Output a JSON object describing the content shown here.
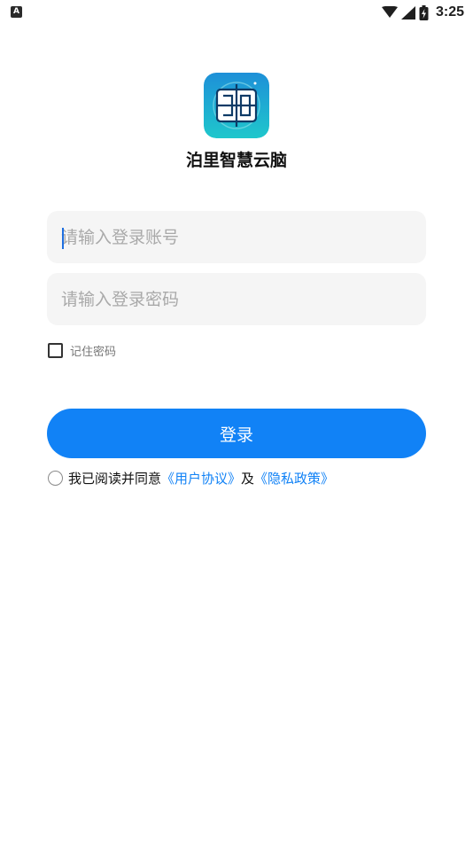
{
  "status_bar": {
    "notification_glyph": "A",
    "time": "3:25",
    "icons": [
      "wifi-icon",
      "signal-icon",
      "battery-icon"
    ]
  },
  "app": {
    "name": "泊里智慧云脑",
    "logo_icon": "app-logo-icon"
  },
  "login_form": {
    "account_placeholder": "请输入登录账号",
    "password_placeholder": "请输入登录密码",
    "remember_label": "记住密码",
    "remember_checked": false,
    "login_button_label": "登录"
  },
  "agreement": {
    "prefix": "我已阅读并同意",
    "user_agreement_link": "《用户协议》",
    "connector": "及",
    "privacy_policy_link": "《隐私政策》",
    "checked": false
  },
  "colors": {
    "accent": "#1182f6",
    "input_background": "#f5f5f5",
    "background": "#ffffff"
  }
}
